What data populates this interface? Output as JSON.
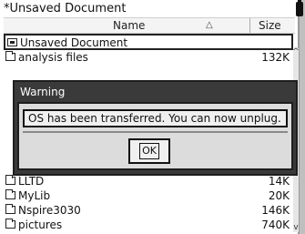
{
  "window": {
    "title": "*Unsaved Document"
  },
  "header": {
    "name_label": "Name",
    "sort_icon": "triangle-up",
    "size_label": "Size"
  },
  "list": {
    "items": [
      {
        "label": "Unsaved Document",
        "size": "",
        "icon": "document-icon"
      },
      {
        "label": "analysis files",
        "size": "132K",
        "icon": "folder-icon"
      },
      {
        "label": "LLTD",
        "size": "14K",
        "icon": "folder-icon"
      },
      {
        "label": "MyLib",
        "size": "20K",
        "icon": "folder-icon"
      },
      {
        "label": "Nspire3030",
        "size": "146K",
        "icon": "folder-icon"
      },
      {
        "label": "pictures",
        "size": "740K",
        "icon": "folder-icon"
      }
    ]
  },
  "dialog": {
    "title": "Warning",
    "message": "OS has been transferred. You can now unplug.",
    "ok_label": "OK"
  },
  "colors": {
    "dialog_bg": "#3a3a3a",
    "dialog_body": "#dcdcdc"
  }
}
